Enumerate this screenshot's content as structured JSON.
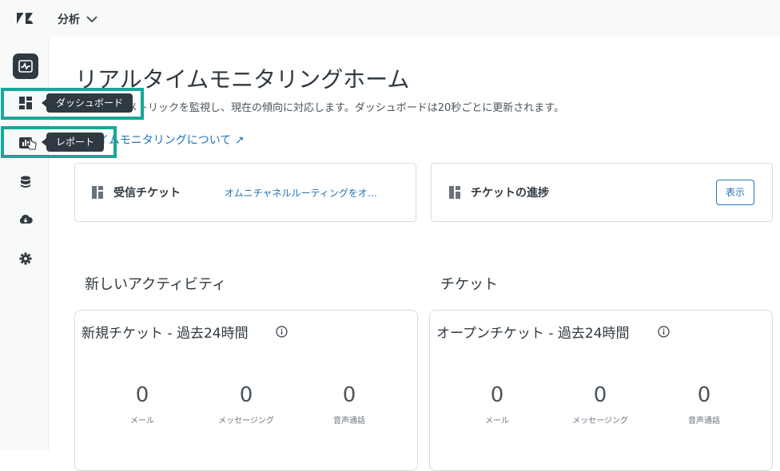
{
  "header": {
    "product": "分析"
  },
  "tooltips": {
    "dashboard": "ダッシュボード",
    "reports": "レポート"
  },
  "page": {
    "title": "リアルタイムモニタリングホーム",
    "description": "ムで主要なメトリックを監視し、現在の傾向に対応します。ダッシュボードは20秒ごとに更新されます。",
    "learn_link": "ルタイムモニタリングについて ↗"
  },
  "widgets": {
    "inbound": {
      "title": "受信チケット",
      "link": "オムニチャネルルーティングをオン..."
    },
    "progress": {
      "title": "チケットの進捗",
      "button": "表示"
    }
  },
  "sections": {
    "activity": "新しいアクティビティ",
    "tickets": "チケット"
  },
  "cards": [
    {
      "title": "新規チケット - 過去24時間",
      "metrics": [
        {
          "value": "0",
          "label": "メール"
        },
        {
          "value": "0",
          "label": "メッセージング"
        },
        {
          "value": "0",
          "label": "音声通話"
        }
      ]
    },
    {
      "title": "オープンチケット - 過去24時間",
      "metrics": [
        {
          "value": "0",
          "label": "メール"
        },
        {
          "value": "0",
          "label": "メッセージング"
        },
        {
          "value": "0",
          "label": "音声通話"
        }
      ]
    }
  ],
  "colors": {
    "highlight": "#17a898",
    "link": "#1f73b7",
    "dark": "#2f3941"
  },
  "icons": [
    "zendesk-logo",
    "chevron-down-icon",
    "monitor-icon",
    "dashboard-icon",
    "reports-icon",
    "database-icon",
    "cloud-download-icon",
    "gear-icon",
    "info-icon",
    "widget-icon"
  ]
}
